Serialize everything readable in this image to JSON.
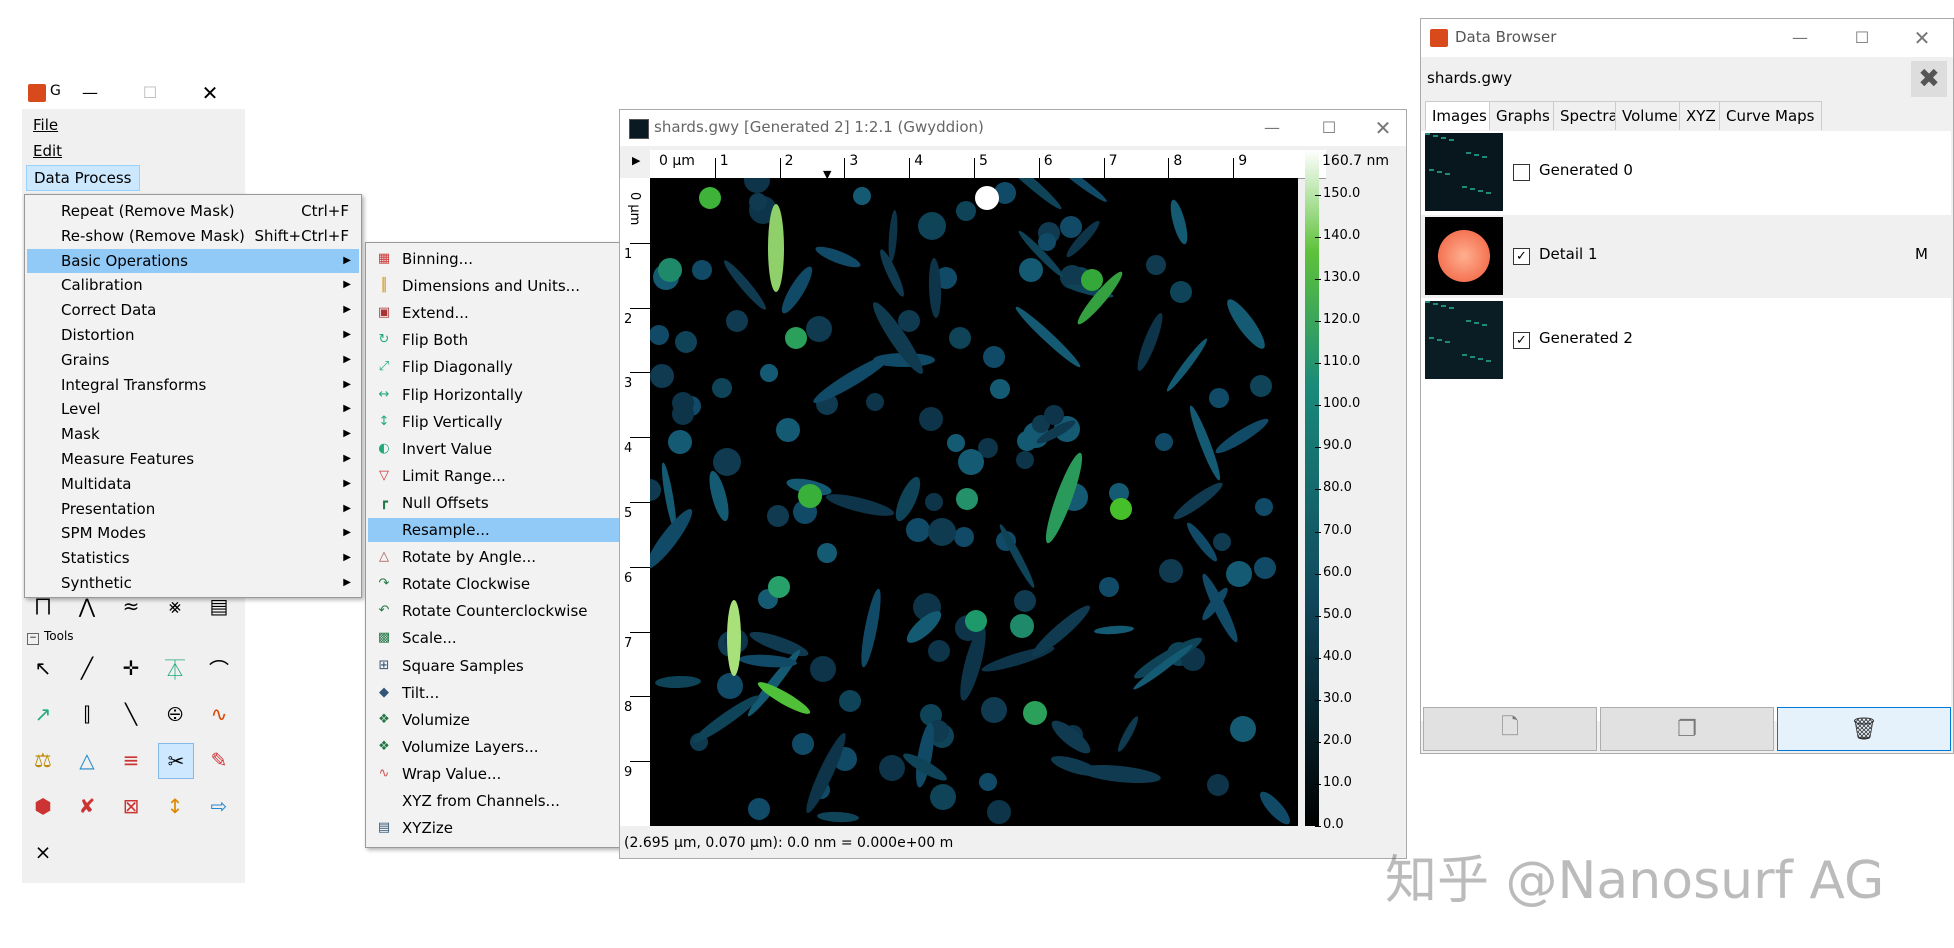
{
  "main_window": {
    "title": "G",
    "menubar": [
      "File",
      "Edit",
      "Data Process"
    ],
    "tools_label": "Tools"
  },
  "data_process_menu": [
    {
      "label": "Repeat (Remove Mask)",
      "shortcut": "Ctrl+F"
    },
    {
      "label": "Re-show (Remove Mask)",
      "shortcut": "Shift+Ctrl+F"
    },
    {
      "label": "Basic Operations",
      "submenu": true,
      "highlighted": true
    },
    {
      "label": "Calibration",
      "submenu": true
    },
    {
      "label": "Correct Data",
      "submenu": true
    },
    {
      "label": "Distortion",
      "submenu": true
    },
    {
      "label": "Grains",
      "submenu": true
    },
    {
      "label": "Integral Transforms",
      "submenu": true
    },
    {
      "label": "Level",
      "submenu": true
    },
    {
      "label": "Mask",
      "submenu": true
    },
    {
      "label": "Measure Features",
      "submenu": true
    },
    {
      "label": "Multidata",
      "submenu": true
    },
    {
      "label": "Presentation",
      "submenu": true
    },
    {
      "label": "SPM Modes",
      "submenu": true
    },
    {
      "label": "Statistics",
      "submenu": true
    },
    {
      "label": "Synthetic",
      "submenu": true
    }
  ],
  "basic_operations_menu": [
    {
      "label": "Binning...",
      "icon": "binning-icon"
    },
    {
      "label": "Dimensions and Units...",
      "icon": "dimensions-icon"
    },
    {
      "label": "Extend...",
      "icon": "extend-icon"
    },
    {
      "label": "Flip Both",
      "icon": "flip-both-icon"
    },
    {
      "label": "Flip Diagonally",
      "icon": "flip-diagonally-icon"
    },
    {
      "label": "Flip Horizontally",
      "icon": "flip-horizontally-icon"
    },
    {
      "label": "Flip Vertically",
      "icon": "flip-vertically-icon"
    },
    {
      "label": "Invert Value",
      "icon": "invert-value-icon"
    },
    {
      "label": "Limit Range...",
      "icon": "limit-range-icon"
    },
    {
      "label": "Null Offsets",
      "icon": "null-offsets-icon"
    },
    {
      "label": "Resample...",
      "icon": "",
      "highlighted": true
    },
    {
      "label": "Rotate by Angle...",
      "icon": "rotate-angle-icon"
    },
    {
      "label": "Rotate Clockwise",
      "icon": "rotate-cw-icon"
    },
    {
      "label": "Rotate Counterclockwise",
      "icon": "rotate-ccw-icon"
    },
    {
      "label": "Scale...",
      "icon": "scale-icon"
    },
    {
      "label": "Square Samples",
      "icon": "square-samples-icon"
    },
    {
      "label": "Tilt...",
      "icon": "tilt-icon"
    },
    {
      "label": "Volumize",
      "icon": "volumize-icon"
    },
    {
      "label": "Volumize Layers...",
      "icon": "volumize-layers-icon"
    },
    {
      "label": "Wrap Value...",
      "icon": "wrap-value-icon"
    },
    {
      "label": "XYZ from Channels...",
      "icon": ""
    },
    {
      "label": "XYZize",
      "icon": "xyzize-icon"
    }
  ],
  "image_window": {
    "title": "shards.gwy [Generated 2] 1:2.1 (Gwyddion)",
    "x_axis_unit": "0 μm",
    "x_ticks": [
      "1",
      "2",
      "3",
      "4",
      "5",
      "6",
      "7",
      "8",
      "9"
    ],
    "y_axis_unit": "0 μm",
    "y_ticks": [
      "1",
      "2",
      "3",
      "4",
      "5",
      "6",
      "7",
      "8",
      "9"
    ],
    "colorbar_max": "160.7 nm",
    "colorbar_ticks": [
      "150.0",
      "140.0",
      "130.0",
      "120.0",
      "110.0",
      "100.0",
      "90.0",
      "80.0",
      "70.0",
      "60.0",
      "50.0",
      "40.0",
      "30.0",
      "20.0",
      "10.0",
      "0.0"
    ],
    "status": "(2.695 μm, 0.070 μm): 0.0 nm = 0.000e+00 m"
  },
  "data_browser": {
    "title": "Data Browser",
    "filename": "shards.gwy",
    "tabs": [
      "Images",
      "Graphs",
      "Spectra",
      "Volume",
      "XYZ",
      "Curve Maps"
    ],
    "rows": [
      {
        "name": "Generated 0",
        "checked": false,
        "flag": ""
      },
      {
        "name": "Detail 1",
        "checked": true,
        "flag": "M"
      },
      {
        "name": "Generated 2",
        "checked": true,
        "flag": ""
      }
    ]
  },
  "watermark": "知乎 @Nanosurf AG"
}
